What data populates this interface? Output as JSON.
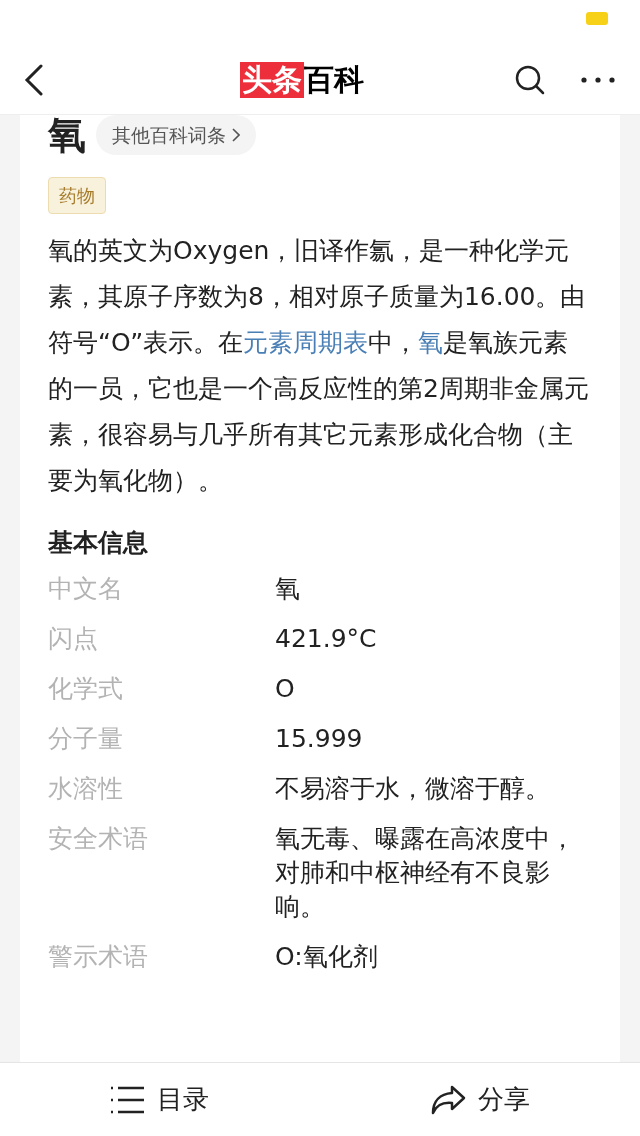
{
  "header": {
    "logo_highlight": "头条",
    "logo_rest": "百科"
  },
  "entry": {
    "title": "氧",
    "other_entries": "其他百科词条",
    "tag": "药物"
  },
  "summary": [
    {
      "text": "氧的英文为Oxygen，旧译作氱，是一种化学元素，其原子序数为8，相对原子质量为16.00。由符号“O”表示。在",
      "link": false
    },
    {
      "text": "元素周期表",
      "link": true
    },
    {
      "text": "中，",
      "link": false
    },
    {
      "text": "氧",
      "link": true
    },
    {
      "text": "是氧族元素的一员，它也是一个高反应性的第2周期非金属元素，很容易与几乎所有其它元素形成化合物（主要为氧化物）。",
      "link": false
    }
  ],
  "basic_info": {
    "heading": "基本信息",
    "rows": [
      {
        "label": "中文名",
        "value": "氧"
      },
      {
        "label": "闪点",
        "value": "421.9°C"
      },
      {
        "label": "化学式",
        "value": "O"
      },
      {
        "label": "分子量",
        "value": "15.999"
      },
      {
        "label": "水溶性",
        "value": "不易溶于水，微溶于醇。"
      },
      {
        "label": "安全术语",
        "value": "氧无毒、曝露在高浓度中，对肺和中枢神经有不良影响。"
      },
      {
        "label": "警示术语",
        "value": "O:氧化剂"
      }
    ]
  },
  "bottom_bar": {
    "contents": "目录",
    "share": "分享"
  }
}
